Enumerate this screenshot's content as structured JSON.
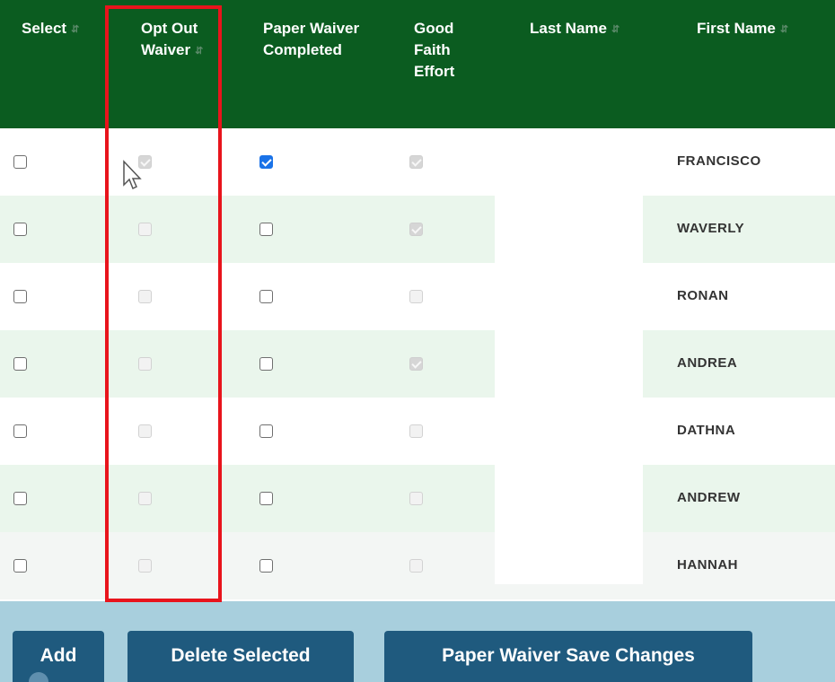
{
  "table": {
    "columns": [
      {
        "label": "Select",
        "sortable": true
      },
      {
        "label": "Opt Out\nWaiver",
        "sortable": true
      },
      {
        "label": "Paper Waiver\nCompleted",
        "sortable": false
      },
      {
        "label": "Good\nFaith\nEffort",
        "sortable": false
      },
      {
        "label": "Last Name",
        "sortable": true
      },
      {
        "label": "First Name",
        "sortable": true
      }
    ],
    "rows": [
      {
        "first_name": "FRANCISCO",
        "select": false,
        "opt_out_waiver": true,
        "paper_waiver_completed": true,
        "good_faith_effort": true
      },
      {
        "first_name": "WAVERLY",
        "select": false,
        "opt_out_waiver": false,
        "paper_waiver_completed": false,
        "good_faith_effort": true
      },
      {
        "first_name": "RONAN",
        "select": false,
        "opt_out_waiver": false,
        "paper_waiver_completed": false,
        "good_faith_effort": false
      },
      {
        "first_name": "ANDREA",
        "select": false,
        "opt_out_waiver": false,
        "paper_waiver_completed": false,
        "good_faith_effort": true
      },
      {
        "first_name": "DATHNA",
        "select": false,
        "opt_out_waiver": false,
        "paper_waiver_completed": false,
        "good_faith_effort": false
      },
      {
        "first_name": "ANDREW",
        "select": false,
        "opt_out_waiver": false,
        "paper_waiver_completed": false,
        "good_faith_effort": false
      },
      {
        "first_name": "HANNAH",
        "select": false,
        "opt_out_waiver": false,
        "paper_waiver_completed": false,
        "good_faith_effort": false
      }
    ]
  },
  "actions": {
    "add_label": "Add",
    "delete_label": "Delete Selected",
    "save_label": "Paper Waiver Save Changes"
  },
  "icons": {
    "sort": "sort-icon",
    "cursor": "arrow-cursor-icon"
  },
  "colors": {
    "header_bg": "#0b5c20",
    "row_alt_bg": "#eaf6ec",
    "highlight": "#e8141c",
    "button_bg": "#1f5a7e",
    "checked_blue": "#1a73e8"
  }
}
